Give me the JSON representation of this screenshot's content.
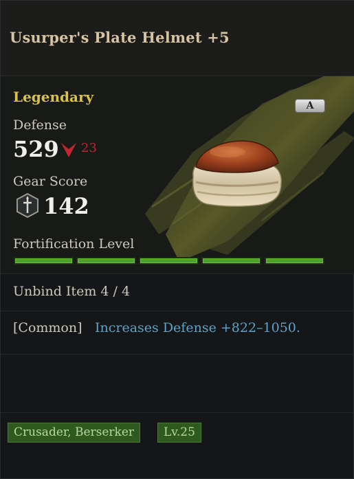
{
  "item": {
    "name": "Usurper's Plate Helmet +5",
    "rarity": "Legendary",
    "grade": "A",
    "rarity_color": "#d9c24e"
  },
  "stats": {
    "defense_label": "Defense",
    "defense_value": "529",
    "defense_diff": "23",
    "defense_diff_direction": "down",
    "gear_score_label": "Gear Score",
    "gear_score_value": "142",
    "fortification_label": "Fortification Level",
    "fortification_filled": 5,
    "fortification_total": 5
  },
  "unbind": {
    "text": "Unbind Item 4 / 4"
  },
  "effect": {
    "tag": "[Common]",
    "text": "Increases Defense +822–1050."
  },
  "requirements": {
    "classes": "Crusader, Berserker",
    "level": "Lv.25"
  },
  "icons": {
    "defense_change": "down-arrow-icon",
    "gear_score": "sword-shield-icon",
    "item_image": "helmet-icon"
  },
  "colors": {
    "title": "#d6c3a1",
    "diff_negative": "#c0272d",
    "effect_text": "#5da2c8",
    "bar_fill": "#4fa02a",
    "tag_bg": "#2f5a1f"
  }
}
